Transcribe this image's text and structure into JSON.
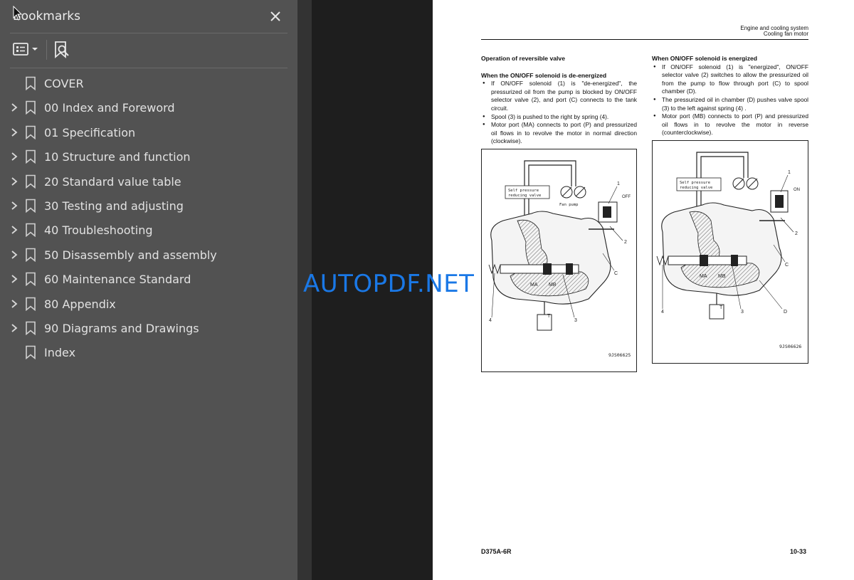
{
  "panel": {
    "title": "Bookmarks",
    "close_icon": "close-icon",
    "view_options_icon": "list-options-icon",
    "find_icon": "find-bookmark-icon"
  },
  "bookmarks": [
    {
      "label": "COVER",
      "expandable": false
    },
    {
      "label": "00 Index and Foreword",
      "expandable": true
    },
    {
      "label": "01 Specification",
      "expandable": true
    },
    {
      "label": "10 Structure and function",
      "expandable": true
    },
    {
      "label": "20 Standard value table",
      "expandable": true
    },
    {
      "label": "30 Testing and adjusting",
      "expandable": true
    },
    {
      "label": "40 Troubleshooting",
      "expandable": true
    },
    {
      "label": "50 Disassembly and assembly",
      "expandable": true
    },
    {
      "label": "60 Maintenance Standard",
      "expandable": true
    },
    {
      "label": "80 Appendix",
      "expandable": true
    },
    {
      "label": "90 Diagrams and Drawings",
      "expandable": true
    },
    {
      "label": "Index",
      "expandable": false
    }
  ],
  "document": {
    "header_line1": "Engine and cooling system",
    "header_line2": "Cooling fan motor",
    "left": {
      "heading": "Operation of reversible valve",
      "subheading": "When the ON/OFF solenoid is de-energized",
      "bullets": [
        "If ON/OFF solenoid (1) is \"de-energized\", the pressurized oil from the pump is blocked by ON/OFF selector valve (2), and port (C) connects to the tank circuit.",
        "Spool (3) is pushed to the right by spring (4).",
        "Motor port (MA) connects to port (P) and pressurized oil flows in to revolve the motor in normal direction (clockwise)."
      ],
      "figure": {
        "box_label_1": "Self pressure",
        "box_label_2": "reducing valve",
        "pump_label": "Fan pump",
        "state": "OFF",
        "code": "9JS06625"
      }
    },
    "right": {
      "subheading": "When ON/OFF solenoid is energized",
      "bullets": [
        "If ON/OFF solenoid (1) is \"energized\", ON/OFF selector valve (2) switches to allow the pressurized oil from the pump to flow through port (C) to spool chamber (D).",
        "The pressurized oil in chamber (D) pushes valve spool (3) to the left against spring (4) .",
        "Motor port (MB) connects to port (P) and pressurized oil flows in to revolve the motor in reverse (counterclockwise)."
      ],
      "figure": {
        "box_label_1": "Self pressure",
        "box_label_2": "reducing valve",
        "state": "ON",
        "code": "9JS06626"
      }
    },
    "footer_model": "D375A-6R",
    "footer_page": "10-33"
  },
  "watermark": "AUTOPDF.NET"
}
